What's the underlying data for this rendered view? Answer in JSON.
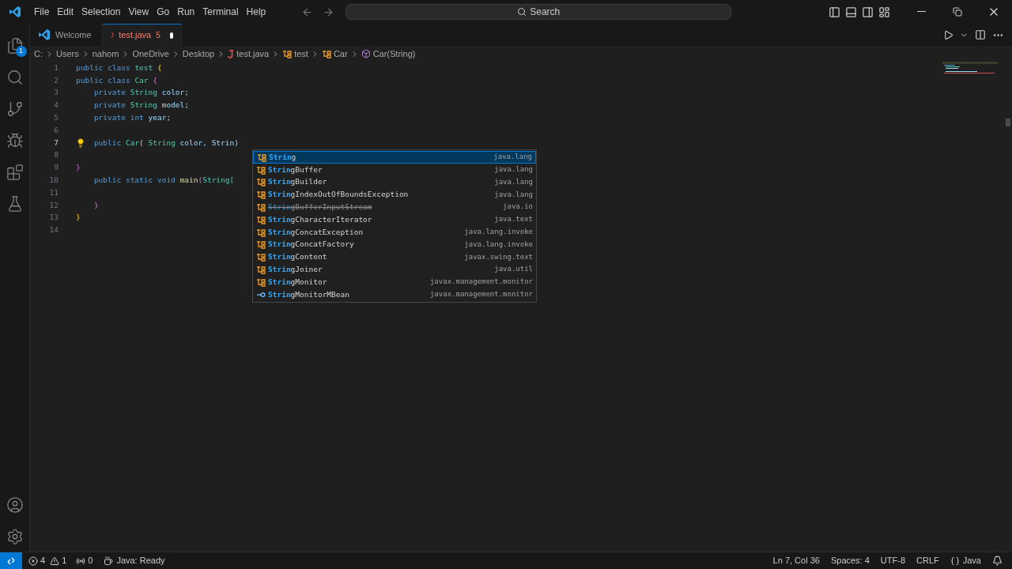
{
  "menu": [
    "File",
    "Edit",
    "Selection",
    "View",
    "Go",
    "Run",
    "Terminal",
    "Help"
  ],
  "search": {
    "placeholder": "Search"
  },
  "activity": [
    {
      "kind": "files",
      "badge": "1"
    },
    {
      "kind": "search"
    },
    {
      "kind": "scm"
    },
    {
      "kind": "debug"
    },
    {
      "kind": "extensions"
    },
    {
      "kind": "testing"
    }
  ],
  "tabs": [
    {
      "label": "Welcome",
      "kind": "welcome",
      "selected": false,
      "dirty": false
    },
    {
      "label": "test.java",
      "kind": "java",
      "selected": true,
      "problems": "5",
      "dirty": true
    }
  ],
  "breadcrumbs": [
    {
      "label": "C:",
      "kind": "folder"
    },
    {
      "label": "Users",
      "kind": "folder"
    },
    {
      "label": "nahom",
      "kind": "folder"
    },
    {
      "label": "OneDrive",
      "kind": "folder"
    },
    {
      "label": "Desktop",
      "kind": "folder"
    },
    {
      "label": "test.java",
      "kind": "java"
    },
    {
      "label": "test",
      "kind": "class"
    },
    {
      "label": "Car",
      "kind": "class"
    },
    {
      "label": "Car(String)",
      "kind": "method"
    }
  ],
  "code": [
    {
      "number": "1",
      "current": false,
      "tokens": [
        {
          "text": "public",
          "kind": "keyword"
        },
        {
          "text": " class ",
          "kind": "keyword"
        },
        {
          "text": "test",
          "kind": "type"
        },
        {
          "text": " {",
          "kind": "brace"
        }
      ]
    },
    {
      "number": "2",
      "current": false,
      "tokens": [
        {
          "text": "public",
          "kind": "keyword"
        },
        {
          "text": " class ",
          "kind": "keyword"
        },
        {
          "text": "Car",
          "kind": "type"
        },
        {
          "text": " {",
          "kind": "brace2"
        }
      ]
    },
    {
      "number": "3",
      "current": false,
      "tokens": [
        {
          "text": "    private ",
          "kind": "keyword"
        },
        {
          "text": "String",
          "kind": "type"
        },
        {
          "text": " color;",
          "kind": "ident"
        }
      ]
    },
    {
      "number": "4",
      "current": false,
      "tokens": [
        {
          "text": "    private ",
          "kind": "keyword"
        },
        {
          "text": "String",
          "kind": "type"
        },
        {
          "text": " model;",
          "kind": "ident"
        }
      ]
    },
    {
      "number": "5",
      "current": false,
      "tokens": [
        {
          "text": "    private ",
          "kind": "keyword"
        },
        {
          "text": "int",
          "kind": "keyword"
        },
        {
          "text": " year;",
          "kind": "ident"
        }
      ]
    },
    {
      "number": "6",
      "current": false
    },
    {
      "number": "7",
      "current": true,
      "tokens": [
        {
          "text": "    public ",
          "kind": "keyword"
        },
        {
          "text": "Car",
          "kind": "type"
        },
        {
          "text": "( ",
          "kind": "plain"
        },
        {
          "text": "String",
          "kind": "type"
        },
        {
          "text": " color, Strin)",
          "kind": "ident"
        }
      ]
    },
    {
      "number": "8",
      "current": false
    },
    {
      "number": "9",
      "current": false,
      "tokens": [
        {
          "text": "}",
          "kind": "brace2"
        }
      ]
    },
    {
      "number": "10",
      "current": false,
      "tokens": [
        {
          "text": "    public static void ",
          "kind": "keyword"
        },
        {
          "text": "main",
          "kind": "func"
        },
        {
          "text": "(",
          "kind": "brace2"
        },
        {
          "text": "String[",
          "kind": "type"
        }
      ]
    },
    {
      "number": "11",
      "current": false
    },
    {
      "number": "12",
      "current": false,
      "tokens": [
        {
          "text": "    }",
          "kind": "brace2"
        }
      ]
    },
    {
      "number": "13",
      "current": false,
      "tokens": [
        {
          "text": "}",
          "kind": "brace"
        }
      ]
    },
    {
      "number": "14",
      "current": false
    }
  ],
  "suggestions": [
    {
      "match": "Strin",
      "rest": "g",
      "detail": "java.lang",
      "kind": "class",
      "selected": true,
      "deprecated": false
    },
    {
      "match": "Strin",
      "rest": "gBuffer",
      "detail": "java.lang",
      "kind": "class",
      "selected": false,
      "deprecated": false
    },
    {
      "match": "Strin",
      "rest": "gBuilder",
      "detail": "java.lang",
      "kind": "class",
      "selected": false,
      "deprecated": false
    },
    {
      "match": "Strin",
      "rest": "gIndexOutOfBoundsException",
      "detail": "java.lang",
      "kind": "class",
      "selected": false,
      "deprecated": false
    },
    {
      "match": "Strin",
      "rest": "gBufferInputStream",
      "detail": "java.io",
      "kind": "class",
      "selected": false,
      "deprecated": true
    },
    {
      "match": "Strin",
      "rest": "gCharacterIterator",
      "detail": "java.text",
      "kind": "class",
      "selected": false,
      "deprecated": false
    },
    {
      "match": "Strin",
      "rest": "gConcatException",
      "detail": "java.lang.invoke",
      "kind": "class",
      "selected": false,
      "deprecated": false
    },
    {
      "match": "Strin",
      "rest": "gConcatFactory",
      "detail": "java.lang.invoke",
      "kind": "class",
      "selected": false,
      "deprecated": false
    },
    {
      "match": "Strin",
      "rest": "gContent",
      "detail": "javax.swing.text",
      "kind": "class",
      "selected": false,
      "deprecated": false
    },
    {
      "match": "Strin",
      "rest": "gJoiner",
      "detail": "java.util",
      "kind": "class",
      "selected": false,
      "deprecated": false
    },
    {
      "match": "Strin",
      "rest": "gMonitor",
      "detail": "javax.management.monitor",
      "kind": "class",
      "selected": false,
      "deprecated": false
    },
    {
      "match": "Strin",
      "rest": "gMonitorMBean",
      "detail": "javax.management.monitor",
      "kind": "interface",
      "selected": false,
      "deprecated": false
    }
  ],
  "status_bar": {
    "errors": "4",
    "warnings": "1",
    "ports": "0",
    "java_status": "Java: Ready",
    "position": "Ln 7, Col 36",
    "spaces": "Spaces: 4",
    "encoding": "UTF-8",
    "eol": "CRLF",
    "language": "Java"
  }
}
